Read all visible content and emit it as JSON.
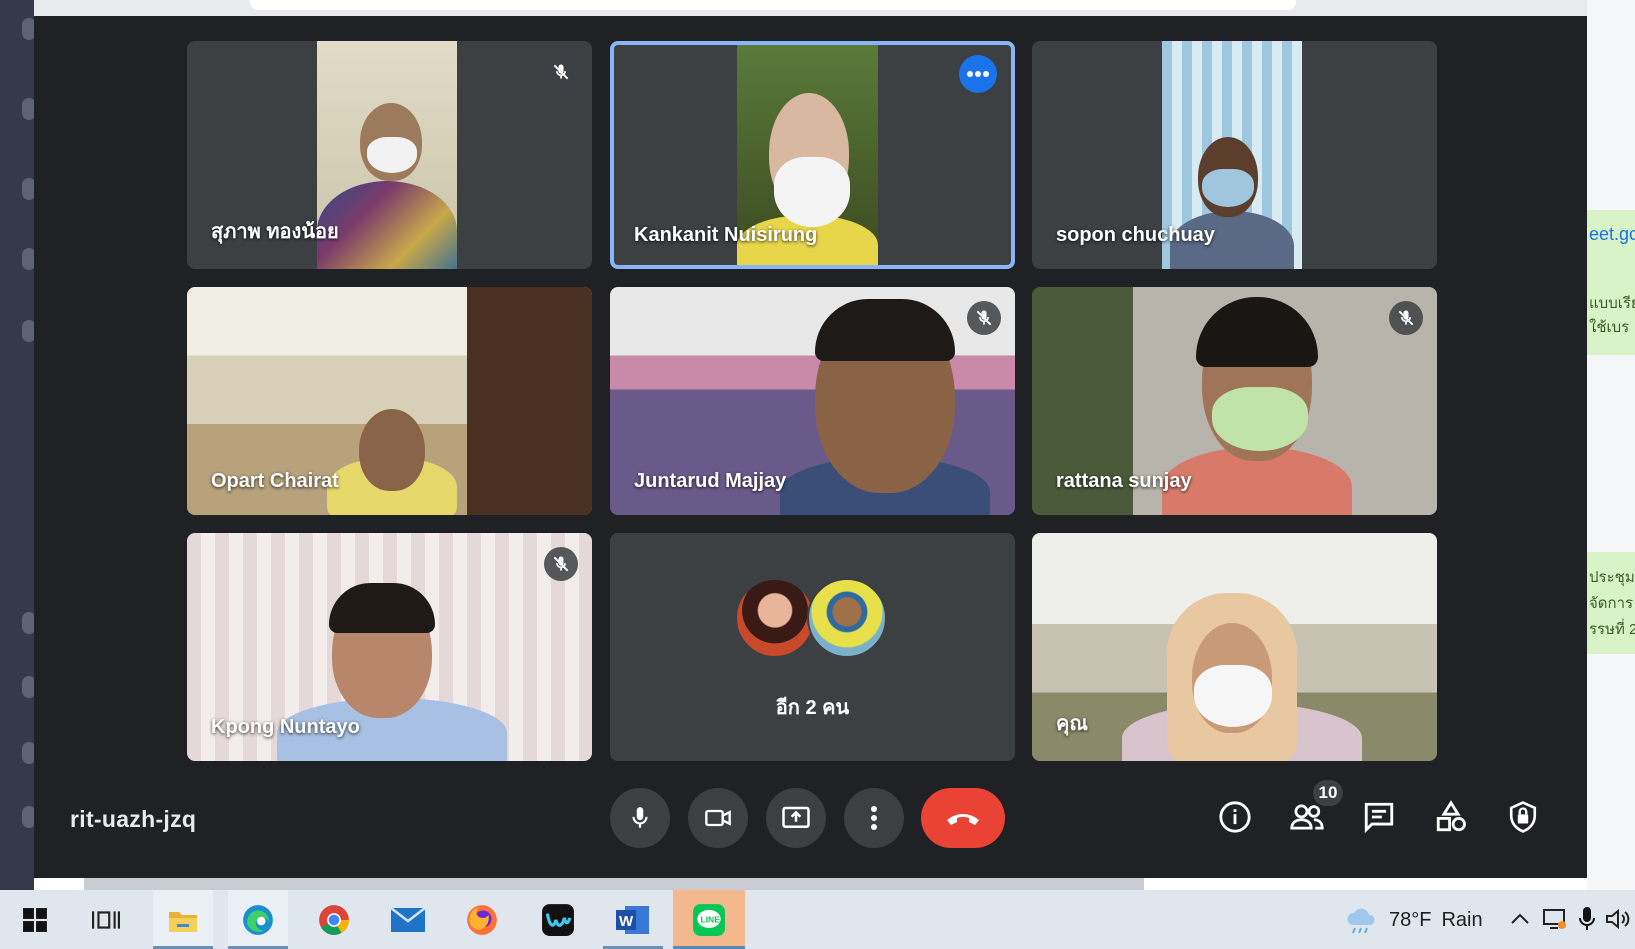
{
  "meeting": {
    "code": "rit-uazh-jzq",
    "participant_count": "10"
  },
  "tiles": [
    {
      "name": "สุภาพ ทองน้อย",
      "muted": true
    },
    {
      "name": "Kankanit Nuisirung",
      "active": true
    },
    {
      "name": "sopon chuchuay"
    },
    {
      "name": "Opart Chairat"
    },
    {
      "name": "Juntarud Majjay",
      "muted": true
    },
    {
      "name": "rattana sunjay",
      "muted": true
    },
    {
      "name": "Kpong Nuntayo",
      "muted": true
    },
    {
      "others_label": "อีก 2 คน"
    },
    {
      "name": "คุณ"
    }
  ],
  "controls": {
    "mic_icon": "microphone-icon",
    "camera_icon": "video-camera-icon",
    "present_icon": "present-screen-icon",
    "more_icon": "more-vert-icon",
    "end_icon": "call-end-icon",
    "info_icon": "info-icon",
    "people_icon": "people-icon",
    "chat_icon": "chat-icon",
    "activities_icon": "activities-icon",
    "host_icon": "host-controls-icon"
  },
  "background_window": {
    "link_fragment": "eet.gc",
    "text_1a": "แบบเรีย",
    "text_1b": "ใช้เบร",
    "text_2a": "ประชุม",
    "text_2b": "จัดการ",
    "text_2c": "รรษที่ 2"
  },
  "taskbar": {
    "weather_temp": "78°F",
    "weather_text": "Rain",
    "apps": [
      "windows-start",
      "task-view",
      "file-explorer",
      "edge",
      "chrome",
      "mail",
      "firefox",
      "webex",
      "word",
      "line"
    ],
    "colors": {
      "accent": "#1a73e8",
      "end_call": "#ea4335",
      "active_border": "#8ab4f8"
    }
  }
}
